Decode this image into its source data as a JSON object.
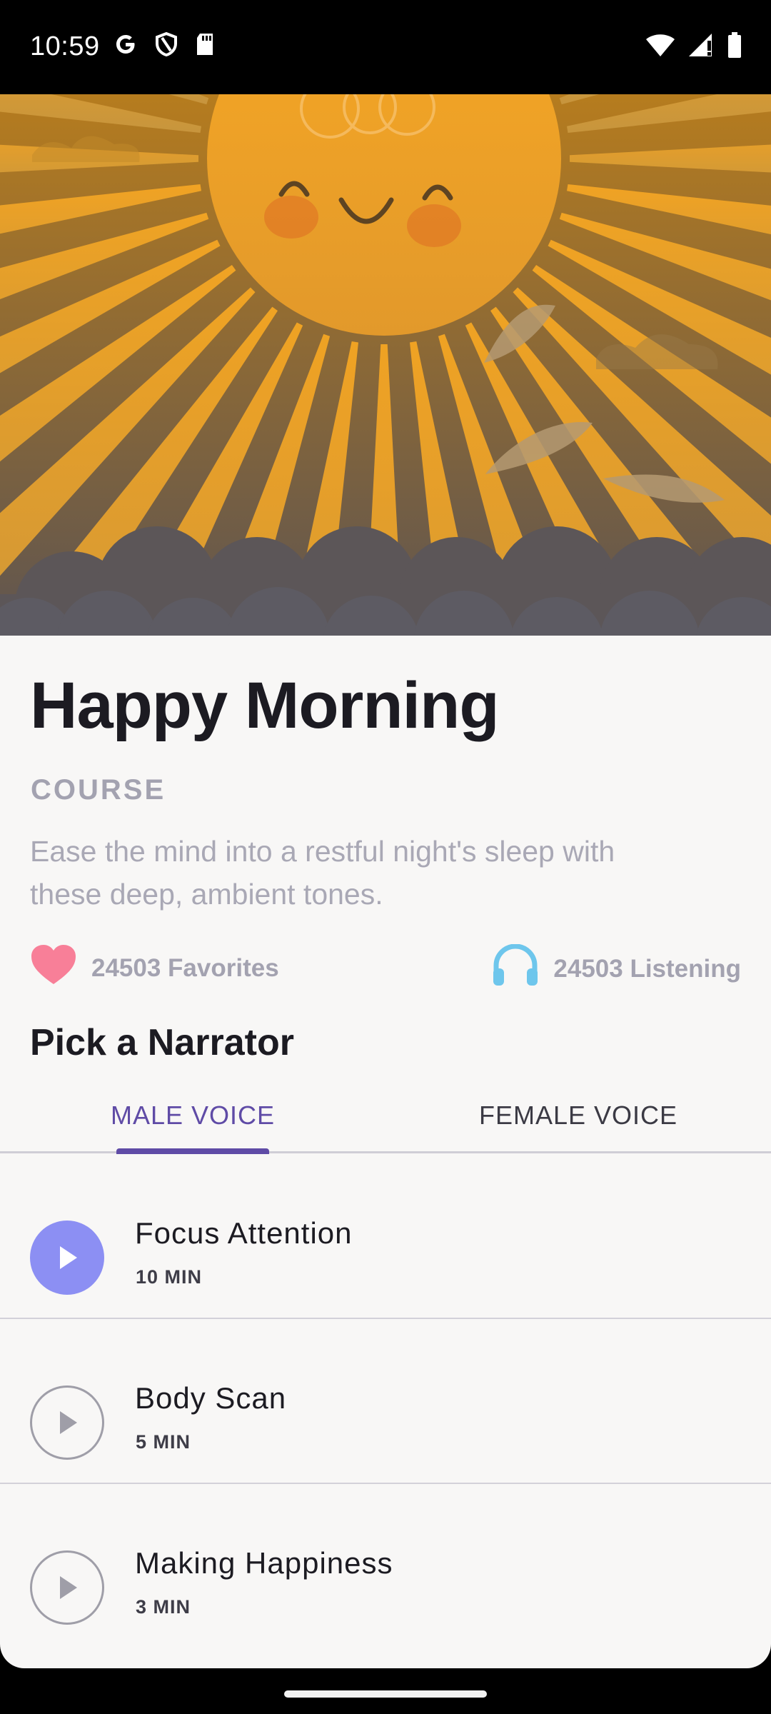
{
  "status_bar": {
    "time": "10:59",
    "left_icons": [
      "google-icon",
      "shield-icon",
      "sd-card-icon"
    ],
    "right_icons": [
      "wifi-icon",
      "cell-signal-icon",
      "battery-icon"
    ]
  },
  "hero": {
    "illustration": "smiling-sun-with-clouds-and-feathers",
    "colors": {
      "sun": "#f6a623",
      "sky_top": "#d88f1c",
      "sky_bottom": "#6a5d58",
      "clouds": "#56535c"
    }
  },
  "course": {
    "title": "Happy Morning",
    "type_label": "COURSE",
    "description": "Ease the mind into a restful night's sleep with these deep, ambient tones.",
    "favorites": "24503 Favorites",
    "listening": "24503 Listening"
  },
  "narrator": {
    "heading": "Pick a Narrator",
    "tabs": [
      {
        "label": "MALE VOICE",
        "selected": true
      },
      {
        "label": "FEMALE VOICE",
        "selected": false
      }
    ]
  },
  "tracks": [
    {
      "name": "Focus Attention",
      "length": "10 MIN",
      "active": true
    },
    {
      "name": "Body Scan",
      "length": "5 MIN",
      "active": false
    },
    {
      "name": "Making Happiness",
      "length": "3 MIN",
      "active": false
    }
  ],
  "colors": {
    "accent": "#5f4ba6",
    "play_active": "#8c8ff3",
    "heart": "#f87f98",
    "headphones": "#6ec6ec",
    "sheet_bg": "#f8f7f6"
  }
}
